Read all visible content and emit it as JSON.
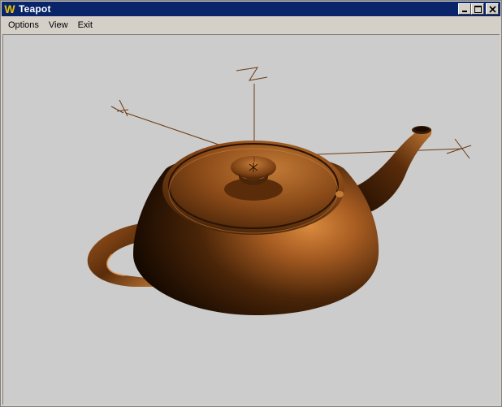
{
  "window": {
    "title": "Teapot",
    "app_icon_letter": "W"
  },
  "menu": {
    "items": [
      {
        "label": "Options"
      },
      {
        "label": "View"
      },
      {
        "label": "Exit"
      }
    ]
  },
  "scene": {
    "background": "#cccccc",
    "teapot_color": "#a0561c",
    "axis_color": "#6b3a12",
    "axes": [
      {
        "label": "X"
      },
      {
        "label": "Y"
      },
      {
        "label": "Z"
      }
    ]
  }
}
